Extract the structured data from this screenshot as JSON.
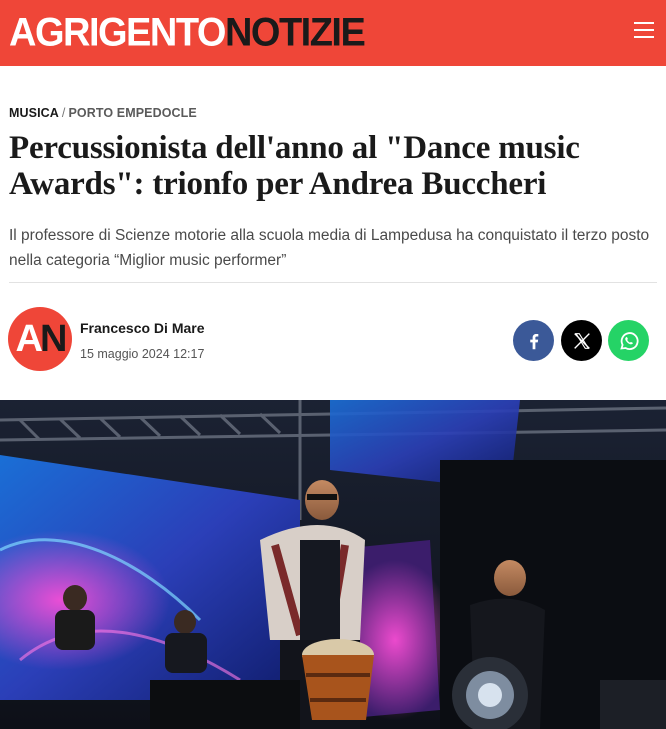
{
  "header": {
    "logo_part1": "AGRIGENTO",
    "logo_part2": "NOTIZIE",
    "brand_color": "#ef4638",
    "menu_icon": "hamburger-menu-icon"
  },
  "breadcrumb": {
    "category": "MUSICA",
    "separator": "/",
    "location": "PORTO EMPEDOCLE"
  },
  "article": {
    "title": "Percussionista dell'anno al \"Dance music Awards\": trionfo per Andrea Buccheri",
    "subtitle": "Il professore di Scienze motorie alla scuola media di Lampedusa ha conquistato il terzo posto nella categoria “Miglior music performer”"
  },
  "byline": {
    "avatar_part1": "A",
    "avatar_part2": "N",
    "author": "Francesco Di Mare",
    "date": "15 maggio 2024 12:17"
  },
  "share": {
    "items": [
      {
        "icon": "facebook-icon",
        "color": "#3b5998"
      },
      {
        "icon": "x-twitter-icon",
        "color": "#000000"
      },
      {
        "icon": "whatsapp-icon",
        "color": "#25d366"
      }
    ]
  },
  "hero_image": {
    "icon": "concert-photo"
  }
}
